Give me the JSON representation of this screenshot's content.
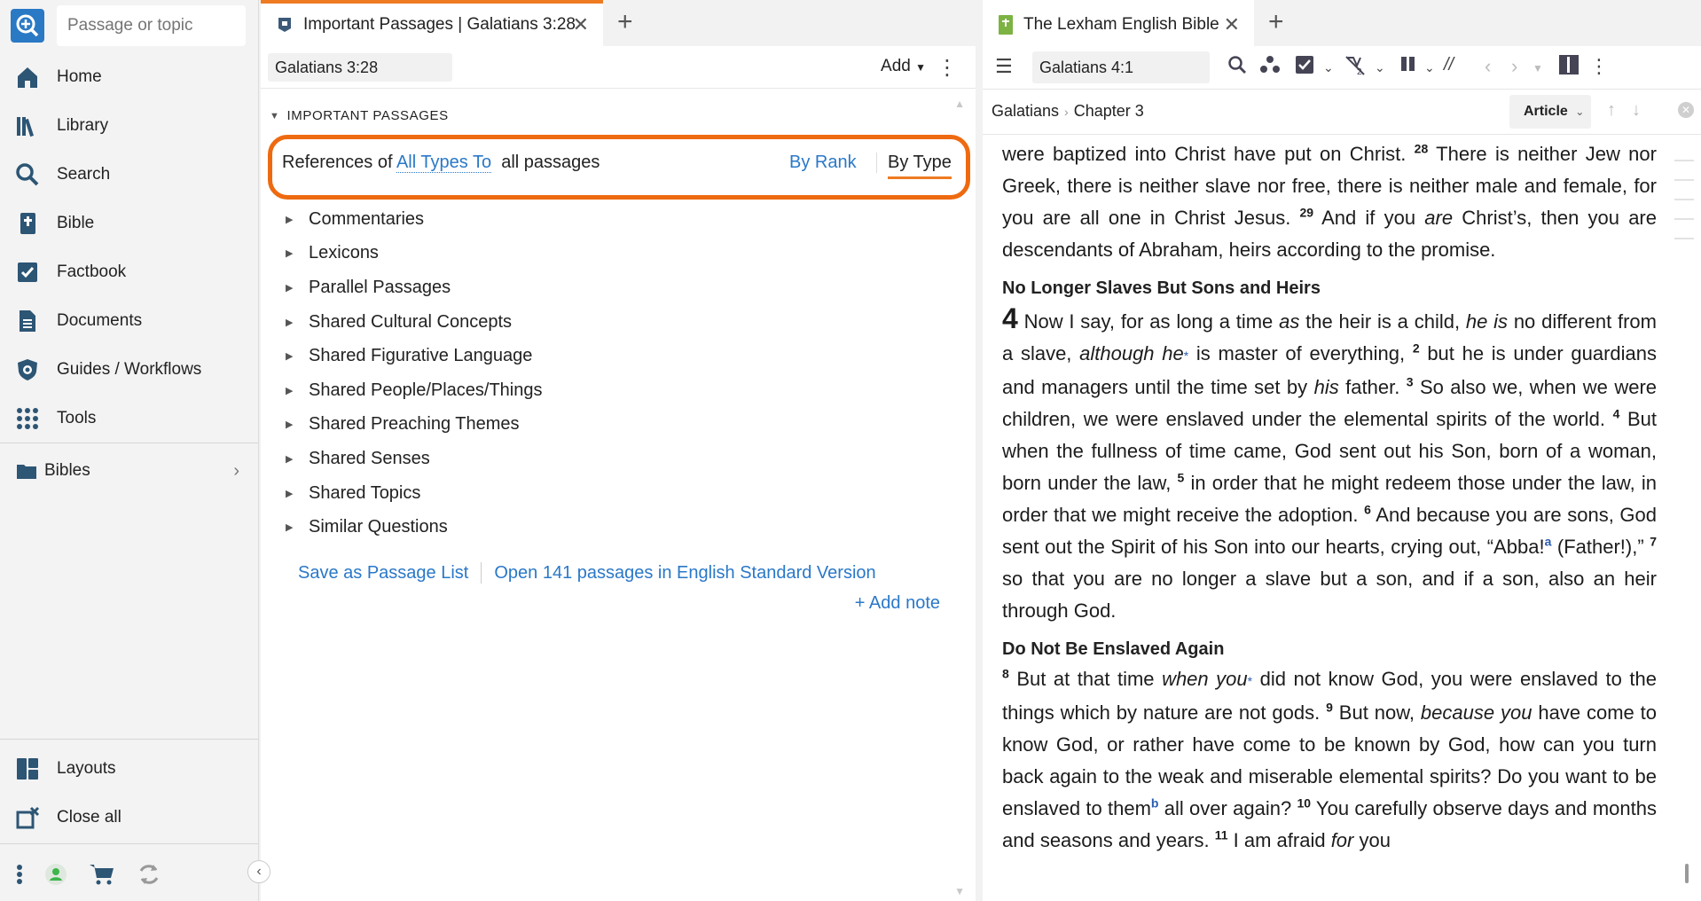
{
  "sidebar": {
    "search_placeholder": "Passage or topic",
    "nav": [
      {
        "label": "Home"
      },
      {
        "label": "Library"
      },
      {
        "label": "Search"
      },
      {
        "label": "Bible"
      },
      {
        "label": "Factbook"
      },
      {
        "label": "Documents"
      },
      {
        "label": "Guides / Workflows"
      },
      {
        "label": "Tools"
      }
    ],
    "bibles_label": "Bibles",
    "bottom": [
      {
        "label": "Layouts"
      },
      {
        "label": "Close all"
      }
    ]
  },
  "mid": {
    "tab_title": "Important Passages | Galatians 3:28",
    "reference": "Galatians 3:28",
    "add_label": "Add",
    "section_title": "IMPORTANT PASSAGES",
    "refs_prefix": "References of",
    "refs_link": "All Types To",
    "refs_suffix": "all passages",
    "by_rank": "By Rank",
    "by_type": "By Type",
    "tree": [
      "Commentaries",
      "Lexicons",
      "Parallel Passages",
      "Shared Cultural Concepts",
      "Shared Figurative Language",
      "Shared People/Places/Things",
      "Shared Preaching Themes",
      "Shared Senses",
      "Shared Topics",
      "Similar Questions"
    ],
    "save_list": "Save as Passage List",
    "open_passages": "Open 141 passages in English Standard Version",
    "add_note": "+ Add note"
  },
  "right": {
    "tab_title": "The Lexham English Bible",
    "reference": "Galatians 4:1",
    "crumb_book": "Galatians",
    "crumb_chapter": "Chapter 3",
    "article_label": "Article",
    "p1_a": "were baptized into Christ have put on Christ. ",
    "v28": "28",
    "p1_b": " There is neither Jew nor Greek, there is neither slave nor free, there is neither male and female, for you are all one in Christ Jesus. ",
    "v29": "29",
    "p1_c": " And if you ",
    "p1_are": "are",
    "p1_d": " Christ’s, then you are descendants of Abraham, heirs according to the promise.",
    "h1": "No Longer Slaves But Sons and Heirs",
    "chap4": "4",
    "p2_a": " Now I say, for as long a time ",
    "p2_as": "as",
    "p2_b": " the heir is a child, ",
    "p2_heis": "he is",
    "p2_c": " no different from a slave, ",
    "p2_although": "although he",
    "p2_star": "*",
    "p2_d": " is master of everything, ",
    "v2": "2",
    "p2_e": " but he is under guardians and managers until the time set by ",
    "p2_his": "his",
    "p2_f": " father. ",
    "v3": "3",
    "p2_g": " So also we, when we were children, we were enslaved under the elemental spirits of the world. ",
    "v4": "4",
    "p2_h": " But when the fullness of time came, God sent out his Son, born of a woman, born under the law, ",
    "v5": "5",
    "p2_i": " in order that he might redeem those under the law, in order that we might receive the adoption. ",
    "v6": "6",
    "p2_j": " And because you are sons, God sent out the Spirit of his Son into our hearts, crying out, “Abba!",
    "note_a": "a",
    "p2_k": " (Father!),” ",
    "v7": "7",
    "p2_l": " so that you are no longer a slave but a son, and if a son, also an heir through God.",
    "h2": "Do Not Be Enslaved Again",
    "v8": "8",
    "p3_a": " But at that time ",
    "p3_whenyou": "when you",
    "p3_star": "*",
    "p3_b": " did not know God, you were enslaved to the things which by nature are not gods. ",
    "v9": "9",
    "p3_c": " But now, ",
    "p3_because": "because you",
    "p3_d": " have come to know God, or rather have come to be known by God, how can you turn back again to the weak and miserable elemental spirits? Do you want to be enslaved to them",
    "note_b": "b",
    "p3_e": " all over again? ",
    "v10": "10",
    "p3_f": " You carefully observe days and months and seasons and years. ",
    "v11": "11",
    "p3_g": " I am afraid ",
    "p3_for": "for",
    "p3_h": " you"
  },
  "colors": {
    "accent_orange": "#ee6a10",
    "link_blue": "#2a78c8",
    "logo_blue": "#2a79c4"
  },
  "icons": [
    "logos-icon",
    "home-icon",
    "library-icon",
    "search-icon",
    "bible-icon",
    "factbook-icon",
    "documents-icon",
    "guides-icon",
    "tools-icon",
    "folder-icon",
    "layouts-icon",
    "close-all-icon",
    "more-icon",
    "user-status-icon",
    "cart-icon",
    "sync-icon"
  ]
}
